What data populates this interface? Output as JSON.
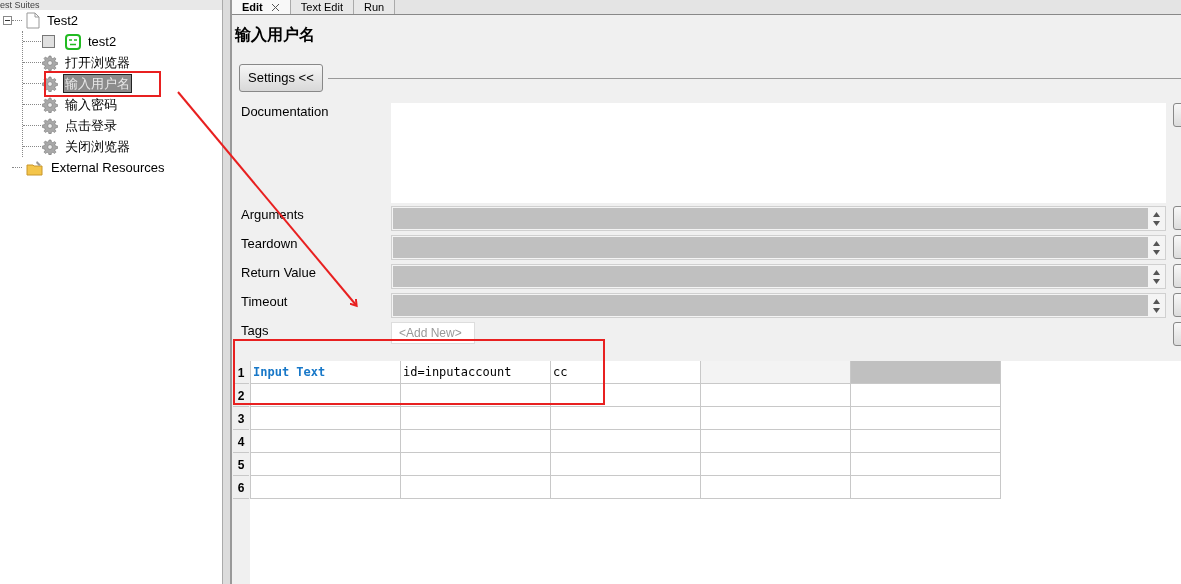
{
  "tree_header": "est Suites",
  "tree": [
    {
      "label": "Test2",
      "kind": "file",
      "expanded": true,
      "selected": false,
      "children": [
        {
          "label": "test2",
          "kind": "testcase",
          "checked": false,
          "selected": false
        },
        {
          "label": "打开浏览器",
          "kind": "keyword",
          "selected": false
        },
        {
          "label": "输入用户名",
          "kind": "keyword",
          "selected": true
        },
        {
          "label": "输入密码",
          "kind": "keyword",
          "selected": false
        },
        {
          "label": "点击登录",
          "kind": "keyword",
          "selected": false
        },
        {
          "label": "关闭浏览器",
          "kind": "keyword",
          "selected": false
        }
      ]
    },
    {
      "label": "External Resources",
      "kind": "resources",
      "selected": false
    }
  ],
  "tabs": [
    {
      "label": "Edit",
      "selected": true,
      "closable": true
    },
    {
      "label": "Text Edit",
      "selected": false,
      "closable": false
    },
    {
      "label": "Run",
      "selected": false,
      "closable": false
    }
  ],
  "title": "输入用户名",
  "settings_button": "Settings <<",
  "fields": [
    {
      "label": "Documentation",
      "kind": "text"
    },
    {
      "label": "Arguments",
      "kind": "list"
    },
    {
      "label": "Teardown",
      "kind": "list"
    },
    {
      "label": "Return Value",
      "kind": "list"
    },
    {
      "label": "Timeout",
      "kind": "list"
    },
    {
      "label": "Tags",
      "kind": "tags",
      "placeholder": "<Add New>"
    }
  ],
  "grid": {
    "rows": [
      {
        "number": "1",
        "cells": [
          {
            "kind": "keyword",
            "text": "Input Text"
          },
          {
            "kind": "arg",
            "text": "id=inputaccount"
          },
          {
            "kind": "arg",
            "text": "cc"
          },
          {
            "kind": "empty_shaded"
          },
          {
            "kind": "disabled"
          }
        ]
      },
      {
        "number": "2",
        "cells": []
      },
      {
        "number": "3",
        "cells": []
      },
      {
        "number": "4",
        "cells": []
      },
      {
        "number": "5",
        "cells": []
      },
      {
        "number": "6",
        "cells": []
      }
    ]
  }
}
